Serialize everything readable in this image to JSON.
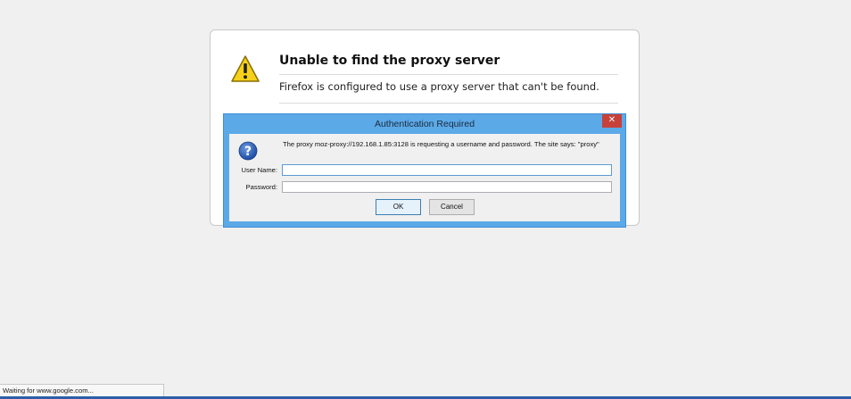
{
  "error_page": {
    "title": "Unable to find the proxy server",
    "description": "Firefox is configured to use a proxy server that can't be found.",
    "icon": "warning-icon"
  },
  "auth_dialog": {
    "title": "Authentication Required",
    "close_label": "✕",
    "icon": "question-icon",
    "message": "The proxy moz-proxy://192.168.1.85:3128 is requesting a username and password. The site says: \"proxy\"",
    "username_label": "User Name:",
    "username_value": "",
    "password_label": "Password:",
    "password_value": "",
    "ok_label": "OK",
    "cancel_label": "Cancel"
  },
  "status_bar": {
    "text": "Waiting for www.google.com..."
  },
  "colors": {
    "dialog_frame": "#5ca9e8",
    "close_button": "#c7413a",
    "warning_yellow": "#f5d11a"
  }
}
